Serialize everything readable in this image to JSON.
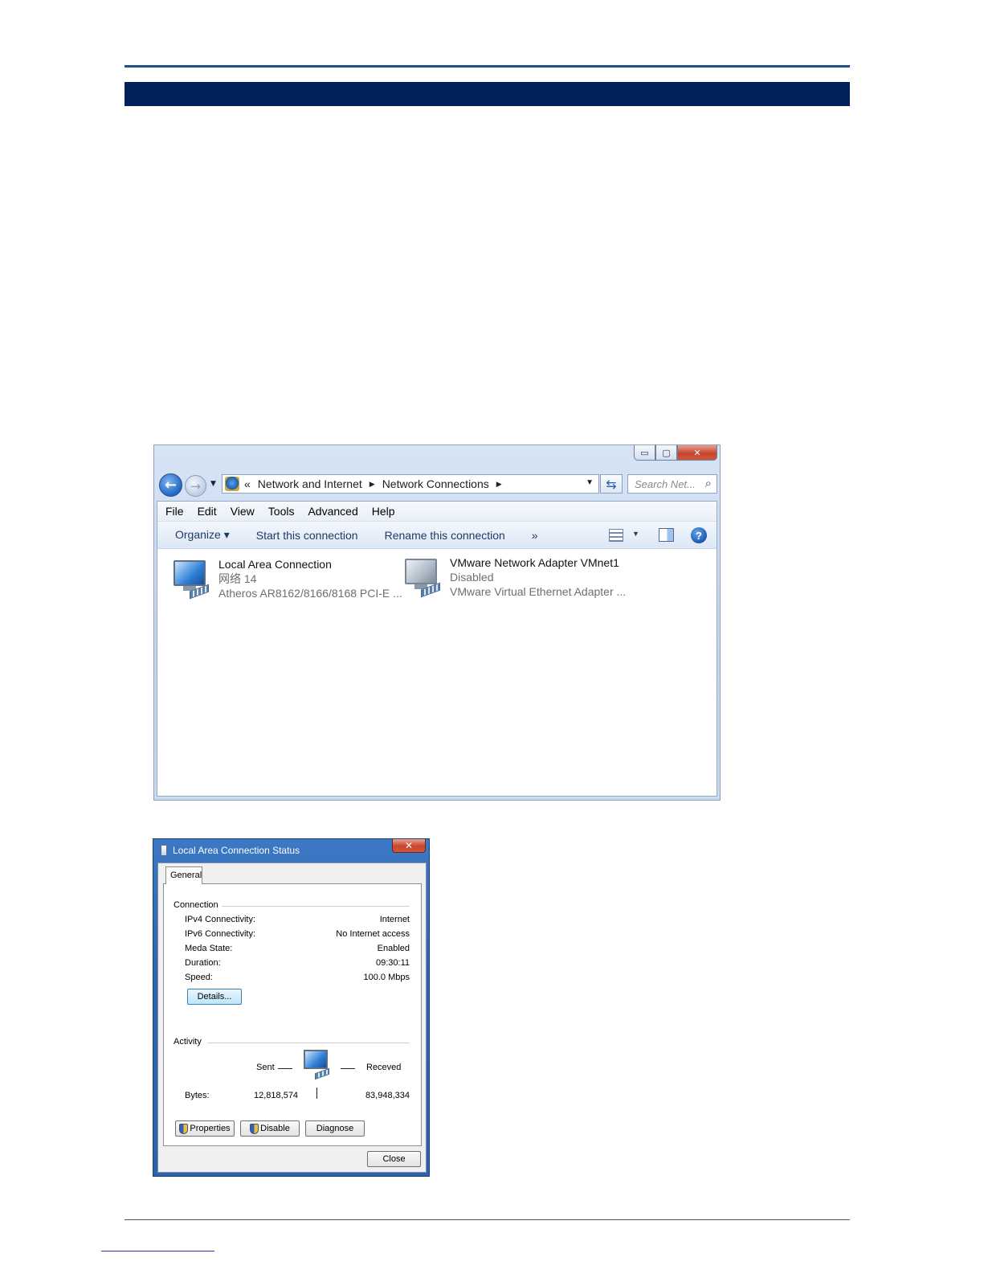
{
  "explorer": {
    "caption_buttons": {
      "minimize": "▭",
      "maximize": "▢",
      "close": "✕"
    },
    "address": {
      "overflow_chevron": "«",
      "segments": [
        "Network and Internet",
        "Network Connections"
      ]
    },
    "search_placeholder": "Search Net...",
    "menu": [
      "File",
      "Edit",
      "View",
      "Tools",
      "Advanced",
      "Help"
    ],
    "commands": {
      "organize": "Organize ▾",
      "start": "Start this connection",
      "rename": "Rename this connection",
      "more": "»"
    },
    "connections": [
      {
        "name": "Local Area Connection",
        "status": "网络 14",
        "device": "Atheros AR8162/8166/8168 PCI-E ..."
      },
      {
        "name": "VMware Network Adapter VMnet1",
        "status": "Disabled",
        "device": "VMware Virtual Ethernet Adapter ..."
      }
    ]
  },
  "status_dialog": {
    "title": "Local Area Connection Status",
    "tab": "General",
    "connection_group": "Connection",
    "rows": [
      {
        "label": "IPv4 Connectivity:",
        "value": "Internet"
      },
      {
        "label": "IPv6 Connectivity:",
        "value": "No Internet access"
      },
      {
        "label": "Meda State:",
        "value": "Enabled"
      },
      {
        "label": "Duration:",
        "value": "09:30:11"
      },
      {
        "label": "Speed:",
        "value": "100.0 Mbps"
      }
    ],
    "details_button": "Details...",
    "activity_group": "Activity",
    "sent_label": "Sent",
    "received_label": "Receved",
    "bytes_label": "Bytes:",
    "bytes_sent": "12,818,574",
    "bytes_received": "83,948,334",
    "buttons": {
      "properties": "Properties",
      "disable": "Disable",
      "diagnose": "Diagnose",
      "close": "Close"
    }
  }
}
